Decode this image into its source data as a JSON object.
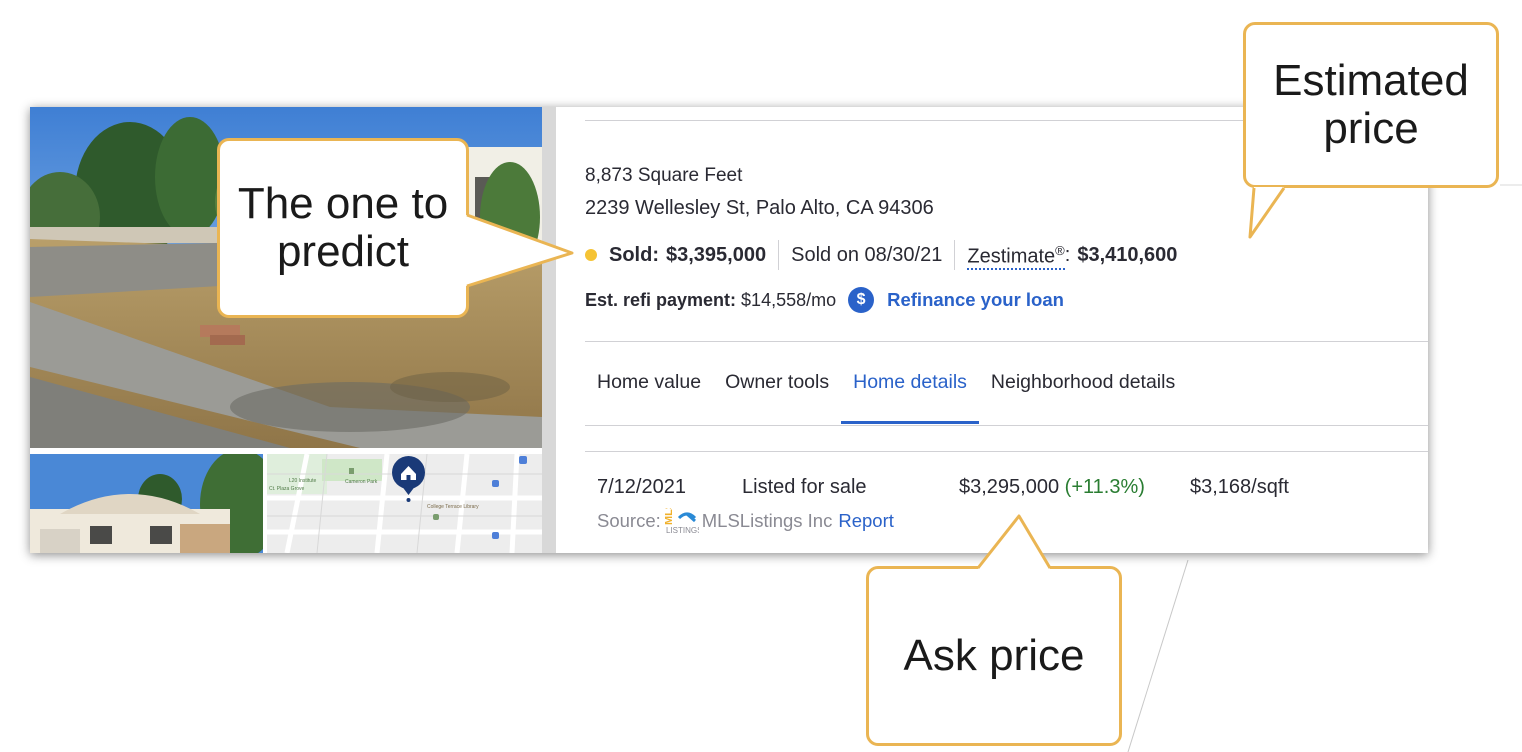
{
  "property": {
    "square_feet": "8,873 Square Feet",
    "address": "2239 Wellesley St, Palo Alto, CA 94306",
    "status_label": "Sold:",
    "sold_price": "$3,395,000",
    "sold_on": "Sold on 08/30/21",
    "zestimate_label": "Zestimate",
    "zestimate_mark": "®",
    "zestimate_suffix": ":",
    "zestimate_value": "$3,410,600",
    "refi_label": "Est. refi payment:",
    "refi_value": "$14,558/mo",
    "refi_icon_glyph": "$",
    "refinance_link": "Refinance your loan"
  },
  "tabs": [
    {
      "label": "Home value",
      "active": false
    },
    {
      "label": "Owner tools",
      "active": false
    },
    {
      "label": "Home details",
      "active": true
    },
    {
      "label": "Neighborhood details",
      "active": false
    }
  ],
  "price_history": {
    "rows": [
      {
        "date": "7/12/2021",
        "event": "Listed for sale",
        "price": "$3,295,000",
        "change": "(+11.3%)",
        "price_per_sqft": "$3,168/sqft"
      }
    ],
    "source_label": "Source:",
    "source_logo_icon": "mls-listings-logo-icon",
    "source_name": "MLSListings Inc",
    "report_link": "Report"
  },
  "map": {
    "labels": [
      "L20 Institute",
      "Cameron Park",
      "College Terrace Library",
      "Ct. Plaza Grove"
    ]
  },
  "callouts": {
    "predict": "The one to predict",
    "estimated": "Estimated price",
    "ask": "Ask price"
  },
  "colors": {
    "accent_blue": "#2a62c9",
    "status_dot": "#f5c335",
    "positive_change": "#2a7d32",
    "callout_border": "#eab553",
    "text": "#2a2a33"
  }
}
